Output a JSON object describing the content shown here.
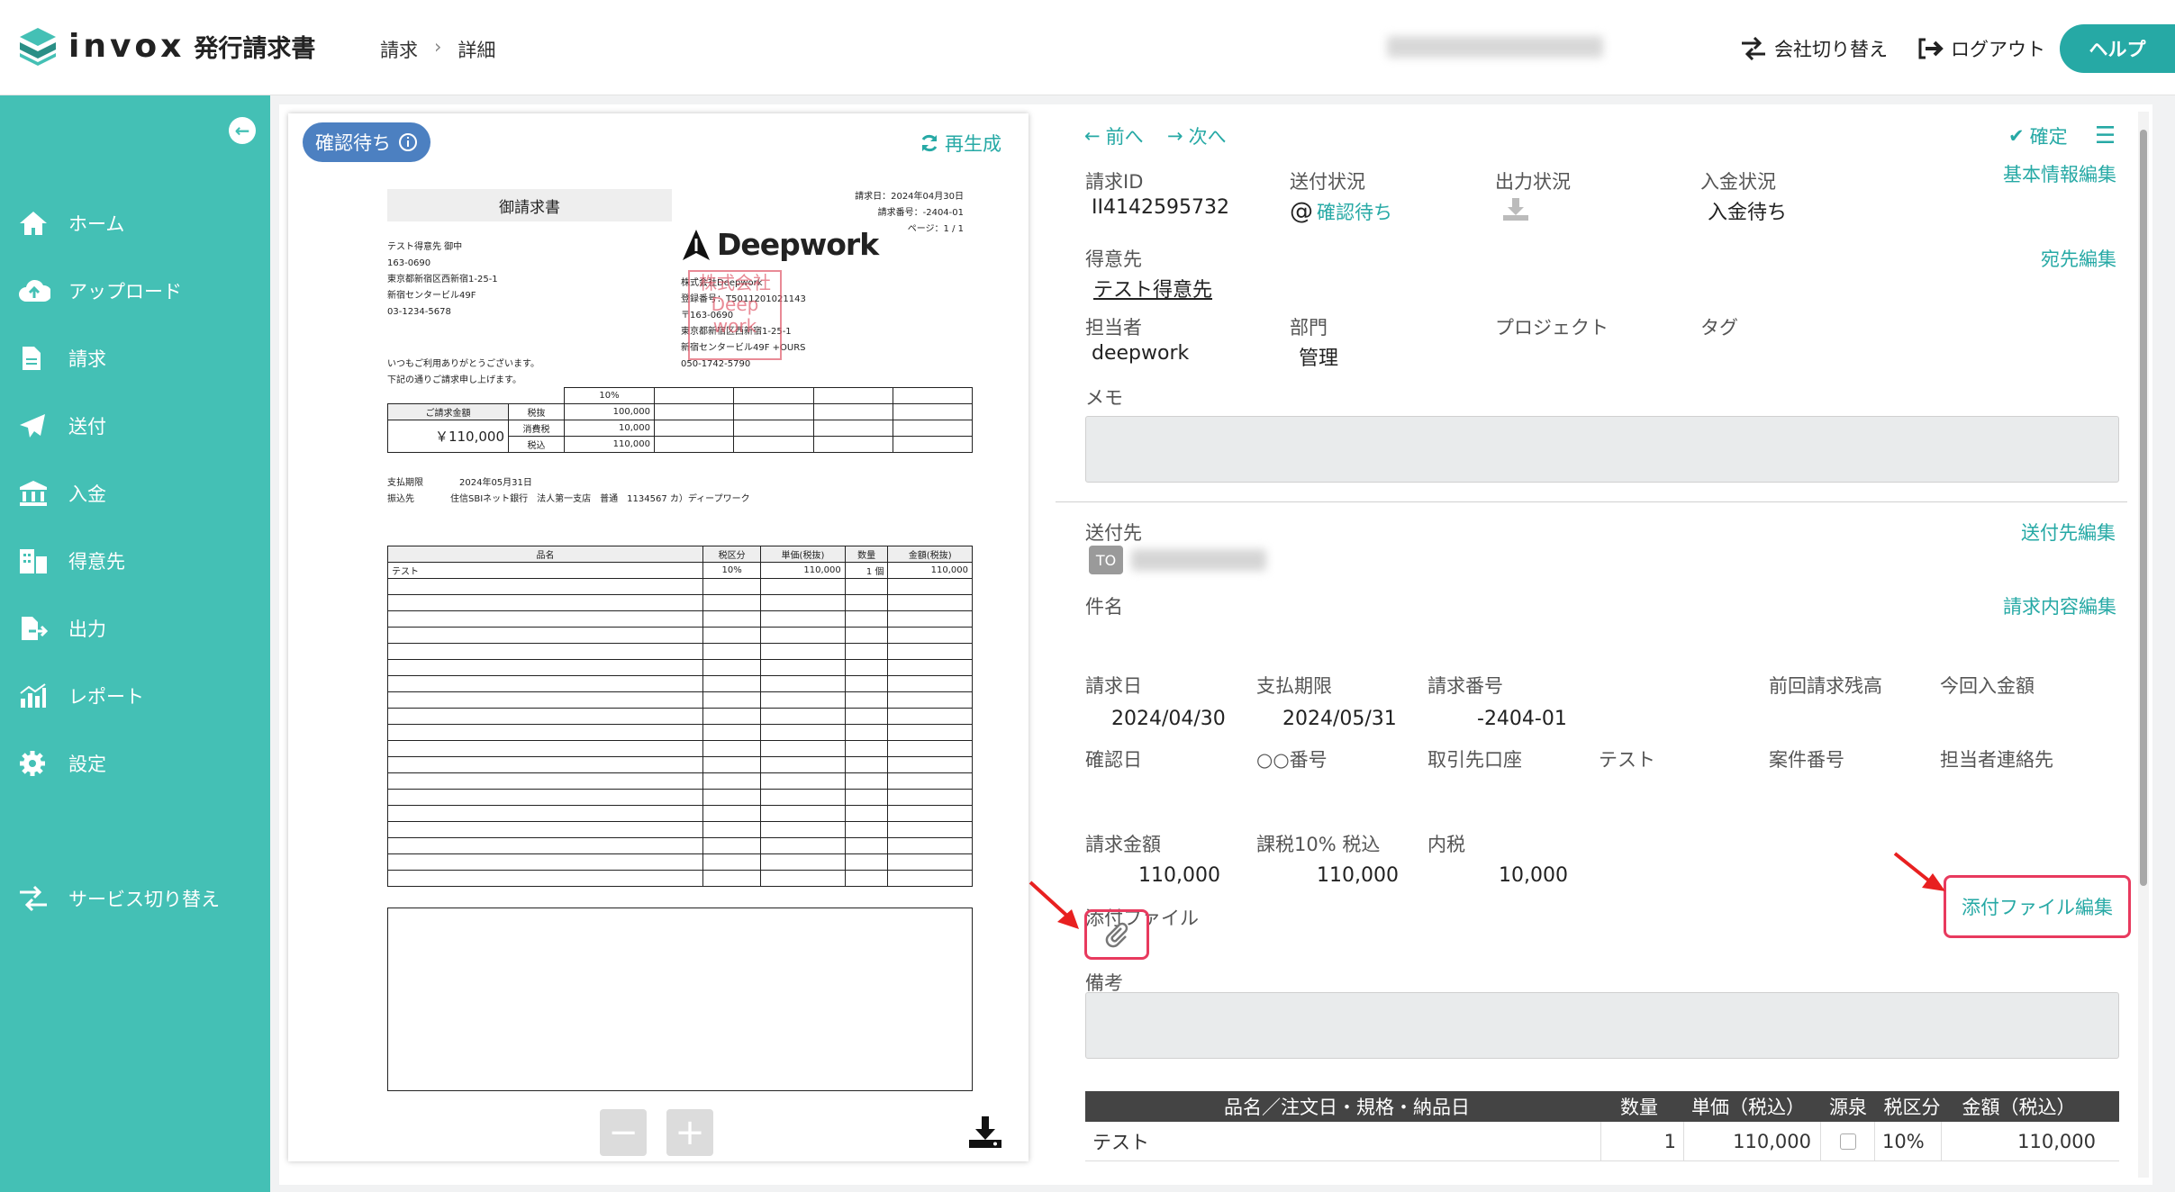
{
  "header": {
    "logo": "invox",
    "logo_sub": "発行請求書",
    "bc1": "請求",
    "bc2": "詳細",
    "switch_company": "会社切り替え",
    "logout": "ログアウト",
    "help": "ヘルプ"
  },
  "sidebar": {
    "items": [
      {
        "label": "ホーム",
        "icon": "home-icon"
      },
      {
        "label": "アップロード",
        "icon": "cloud-upload-icon"
      },
      {
        "label": "請求",
        "icon": "document-icon"
      },
      {
        "label": "送付",
        "icon": "send-icon"
      },
      {
        "label": "入金",
        "icon": "bank-icon"
      },
      {
        "label": "得意先",
        "icon": "building-icon"
      },
      {
        "label": "出力",
        "icon": "export-icon"
      },
      {
        "label": "レポート",
        "icon": "report-icon"
      },
      {
        "label": "設定",
        "icon": "gear-icon"
      }
    ],
    "service_switch": "サービス切り替え"
  },
  "preview": {
    "status": "確認待ち",
    "regen": "再生成",
    "doc": {
      "title": "御請求書",
      "date": "請求日：2024年04月30日",
      "number": "請求番号：-2404-01",
      "page": "ページ：1 / 1",
      "customer": [
        "テスト得意先 御中",
        "163-0690",
        "東京都新宿区西新宿1-25-1",
        "新宿センタービル49F",
        "03-1234-5678"
      ],
      "greeting": [
        "いつもご利用ありがとうございます。",
        "下記の通りご請求申し上げます。"
      ],
      "issuer_logo": "Deepwork",
      "issuer": [
        "株式会社Deepwork",
        "登録番号：T5011201021143",
        "〒163-0690",
        "東京都新宿区西新宿1-25-1",
        "新宿センタービル49F +OURS",
        "050-1742-5790"
      ],
      "stamp": "株式会社 Deep work",
      "summary": {
        "label": "ご請求金額",
        "amount": "￥110,000",
        "rate": "10%",
        "rows": [
          [
            "税抜",
            "100,000"
          ],
          [
            "消費税",
            "10,000"
          ],
          [
            "税込",
            "110,000"
          ]
        ]
      },
      "due_label": "支払期限",
      "due": "2024年05月31日",
      "bank_label": "振込先",
      "bank": "住信SBIネット銀行　法人第一支店　普通　1134567 カ）ディープワーク",
      "items_header": [
        "品名",
        "税区分",
        "単価(税抜)",
        "数量",
        "金額(税抜)"
      ],
      "items": [
        [
          "テスト",
          "10%",
          "110,000",
          "1 個",
          "110,000"
        ]
      ]
    }
  },
  "detail": {
    "prev": "前へ",
    "next": "次へ",
    "confirm": "確定",
    "invoice_id_label": "請求ID",
    "invoice_id": "II4142595732",
    "send_status_label": "送付状況",
    "send_status": "確認待ち",
    "output_status_label": "出力状況",
    "payment_status_label": "入金状況",
    "payment_status": "入金待ち",
    "basic_edit": "基本情報編集",
    "customer_label": "得意先",
    "customer": "テスト得意先",
    "dest_edit": "宛先編集",
    "staff_label": "担当者",
    "staff": "deepwork",
    "dept_label": "部門",
    "dept": "管理",
    "project_label": "プロジェクト",
    "tag_label": "タグ",
    "memo_label": "メモ",
    "send_to_label": "送付先",
    "send_to_edit": "送付先編集",
    "to_tag": "TO",
    "subject_label": "件名",
    "content_edit": "請求内容編集",
    "date_label": "請求日",
    "date": "2024/04/30",
    "due_label": "支払期限",
    "due": "2024/05/31",
    "number_label": "請求番号",
    "number": "-2404-01",
    "prev_balance_label": "前回請求残高",
    "this_payment_label": "今回入金額",
    "confirm_date_label": "確認日",
    "order_no_label": "○○番号",
    "bank_label": "取引先口座",
    "bank": "テスト",
    "case_no_label": "案件番号",
    "contact_label": "担当者連絡先",
    "amount_label": "請求金額",
    "amount": "110,000",
    "taxable_label": "課税10% 税込",
    "taxable": "110,000",
    "tax_label": "内税",
    "tax": "10,000",
    "attach_label": "添付ファイル",
    "attach_edit": "添付ファイル編集",
    "remarks_label": "備考",
    "items_header": {
      "name": "品名／注文日・規格・納品日",
      "qty": "数量",
      "price": "単価（税込）",
      "withholding": "源泉",
      "tax_class": "税区分",
      "amount": "金額（税込）"
    },
    "items": [
      {
        "name": "テスト",
        "qty": "1",
        "price": "110,000",
        "tax_class": "10%",
        "amount": "110,000"
      }
    ]
  },
  "colors": {
    "accent": "#26a9a5",
    "sidebar": "#44c0b5",
    "badge": "#4c80c1",
    "highlight": "#e83a5e"
  }
}
